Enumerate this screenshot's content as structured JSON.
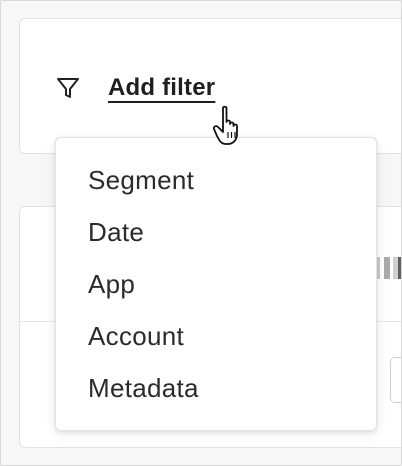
{
  "add_filter": {
    "label": "Add filter",
    "icon": "filter-icon"
  },
  "dropdown": {
    "items": [
      {
        "label": "Segment"
      },
      {
        "label": "Date"
      },
      {
        "label": "App"
      },
      {
        "label": "Account"
      },
      {
        "label": "Metadata"
      }
    ]
  },
  "colors": {
    "background": "#f7f7f7",
    "card": "#ffffff",
    "text": "#2b2b2b",
    "border": "#e2e2e2"
  }
}
